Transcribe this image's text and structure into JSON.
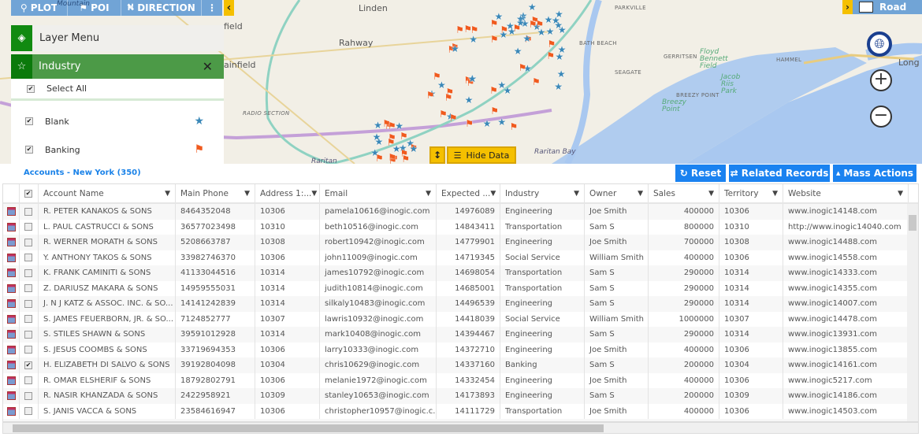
{
  "map": {
    "labels": [
      "Linden",
      "Rahway",
      "field",
      "ainfield",
      "RADIO SECTION",
      "Raritan",
      "Raritan Bay",
      "PARKVILLE",
      "BATH BEACH",
      "GERRITSEN",
      "SEAGATE",
      "Floyd Bennett Field",
      "Jacob Riis Park",
      "BREEZY POINT",
      "Breezy Point",
      "HAMMEL",
      "Long",
      "Mountain"
    ],
    "toolbar": {
      "plot": "PLOT",
      "poi": "POI",
      "direction": "DIRECTION",
      "more": "⋮",
      "collapse": "‹"
    },
    "road_label": "Road",
    "hide_data_label": "Hide Data",
    "zoom_in": "+",
    "zoom_out": "−",
    "layer_menu": {
      "title": "Layer Menu"
    },
    "industry_panel": {
      "title": "Industry",
      "close": "✕",
      "select_all": "Select All",
      "items": [
        {
          "label": "Blank",
          "checked": true,
          "icon": "blue-star-pin-icon"
        },
        {
          "label": "Banking",
          "checked": true,
          "icon": "orange-flag-icon"
        }
      ]
    },
    "colors": {
      "star_pin": "#3a88b8",
      "flag": "#f05a1e",
      "accent_green": "#4c9a47",
      "accent_yellow": "#f5c000",
      "water": "#a9c8f0"
    }
  },
  "grid": {
    "title": "Accounts - New York (350)",
    "buttons": {
      "reset": "Reset",
      "related": "Related Records",
      "mass": "Mass Actions"
    },
    "columns": [
      "Account Name",
      "Main Phone",
      "Address 1:...",
      "Email",
      "Expected ...",
      "Industry",
      "Owner",
      "Sales",
      "Territory",
      "Website"
    ],
    "rows": [
      [
        "R. PETER KANAKOS & SONS",
        "8464352048",
        "10306",
        "pamela10616@inogic.com",
        "14976089",
        "Engineering",
        "Joe Smith",
        "400000",
        "10306",
        "www.inogic14148.com"
      ],
      [
        "L. PAUL CASTRUCCI & SONS",
        "36577023498",
        "10310",
        "beth10516@inogic.com",
        "14843411",
        "Transportation",
        "Sam S",
        "800000",
        "10310",
        "http://www.inogic14040.com"
      ],
      [
        "R. WERNER MORATH & SONS",
        "5208663787",
        "10308",
        "robert10942@inogic.com",
        "14779901",
        "Engineering",
        "Joe Smith",
        "700000",
        "10308",
        "www.inogic14488.com"
      ],
      [
        "Y. ANTHONY TAKOS & SONS",
        "33982746370",
        "10306",
        "john11009@inogic.com",
        "14719345",
        "Social Service",
        "William Smith",
        "400000",
        "10306",
        "www.inogic14558.com"
      ],
      [
        "K. FRANK CAMINITI & SONS",
        "41133044516",
        "10314",
        "james10792@inogic.com",
        "14698054",
        "Transportation",
        "Sam S",
        "290000",
        "10314",
        "www.inogic14333.com"
      ],
      [
        "Z. DARIUSZ MAKARA & SONS",
        "14959555031",
        "10314",
        "judith10814@inogic.com",
        "14685001",
        "Transportation",
        "Sam S",
        "290000",
        "10314",
        "www.inogic14355.com"
      ],
      [
        "J. N J KATZ & ASSOC. INC. & SO...",
        "14141242839",
        "10314",
        "silkaly10483@inogic.com",
        "14496539",
        "Engineering",
        "Sam S",
        "290000",
        "10314",
        "www.inogic14007.com"
      ],
      [
        "S. JAMES FEUERBORN, JR. & SO...",
        "7124852777",
        "10307",
        "lawris10932@inogic.com",
        "14418039",
        "Social Service",
        "William Smith",
        "1000000",
        "10307",
        "www.inogic14478.com"
      ],
      [
        "S. STILES SHAWN & SONS",
        "39591012928",
        "10314",
        "mark10408@inogic.com",
        "14394467",
        "Engineering",
        "Sam S",
        "290000",
        "10314",
        "www.inogic13931.com"
      ],
      [
        "S. JESUS COOMBS & SONS",
        "33719694353",
        "10306",
        "larry10333@inogic.com",
        "14372710",
        "Engineering",
        "Joe Smith",
        "400000",
        "10306",
        "www.inogic13855.com"
      ],
      [
        "H. ELIZABETH DI SALVO & SONS",
        "39192804098",
        "10304",
        "chris10629@inogic.com",
        "14337160",
        "Banking",
        "Sam S",
        "200000",
        "10304",
        "www.inogic14161.com"
      ],
      [
        "R. OMAR ELSHERIF & SONS",
        "18792802791",
        "10306",
        "melanie1972@inogic.com",
        "14332454",
        "Engineering",
        "Joe Smith",
        "400000",
        "10306",
        "www.inogic5217.com"
      ],
      [
        "R. NASIR KHANZADA & SONS",
        "2422958921",
        "10309",
        "stanley10653@inogic.com",
        "14173893",
        "Engineering",
        "Sam S",
        "200000",
        "10309",
        "www.inogic14186.com"
      ],
      [
        "S. JANIS VACCA & SONS",
        "23584616947",
        "10306",
        "christopher10957@inogic.c...",
        "14111729",
        "Transportation",
        "Joe Smith",
        "400000",
        "10306",
        "www.inogic14503.com"
      ]
    ],
    "checked_rows": [
      10
    ],
    "header_checked": true
  }
}
